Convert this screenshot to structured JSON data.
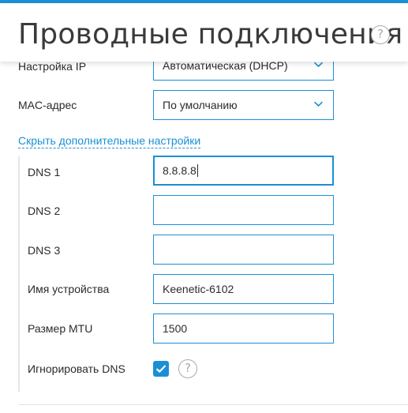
{
  "header": {
    "title": "Проводные подключения",
    "help_symbol": "?"
  },
  "ip_settings": {
    "label": "Настройка IP",
    "value": "Автоматическая (DHCP)"
  },
  "mac_address": {
    "label": "MAC-адрес",
    "value": "По умолчанию"
  },
  "advanced_toggle": {
    "label": "Скрыть дополнительные настройки"
  },
  "dns1": {
    "label": "DNS 1",
    "value": "8.8.8.8"
  },
  "dns2": {
    "label": "DNS 2",
    "value": ""
  },
  "dns3": {
    "label": "DNS 3",
    "value": ""
  },
  "device_name": {
    "label": "Имя устройства",
    "value": "Keenetic-6102"
  },
  "mtu": {
    "label": "Размер MTU",
    "value": "1500"
  },
  "ignore_dns": {
    "label": "Игнорировать DNS",
    "checked": true,
    "help_symbol": "?"
  },
  "colors": {
    "accent": "#1a8fd6",
    "text": "#2b2b2b",
    "muted": "#a9a9a9"
  }
}
